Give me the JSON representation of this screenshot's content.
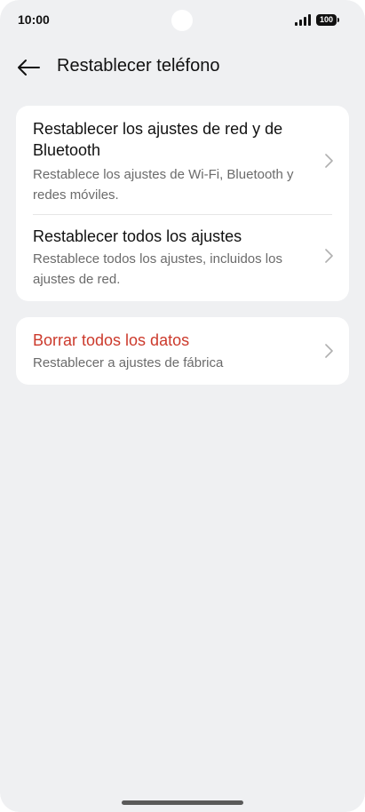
{
  "status_bar": {
    "time": "10:00",
    "battery": "100",
    "icons": [
      "signal-icon",
      "battery-icon"
    ]
  },
  "header": {
    "title": "Restablecer teléfono",
    "back_icon": "back-arrow-icon"
  },
  "sections": [
    {
      "items": [
        {
          "title": "Restablecer los ajustes de red y de Bluetooth",
          "subtitle": "Restablece los ajustes de Wi-Fi, Bluetooth y redes móviles."
        },
        {
          "title": "Restablecer todos los ajustes",
          "subtitle": "Restablece todos los ajustes, incluidos los ajustes de red."
        }
      ]
    },
    {
      "items": [
        {
          "title": "Borrar todos los datos",
          "subtitle": "Restablecer a ajustes de fábrica"
        }
      ]
    }
  ],
  "colors": {
    "background": "#eff0f2",
    "card": "#ffffff",
    "danger": "#cc3a2c",
    "text": "#111111",
    "secondary_text": "#6b6b6b"
  }
}
